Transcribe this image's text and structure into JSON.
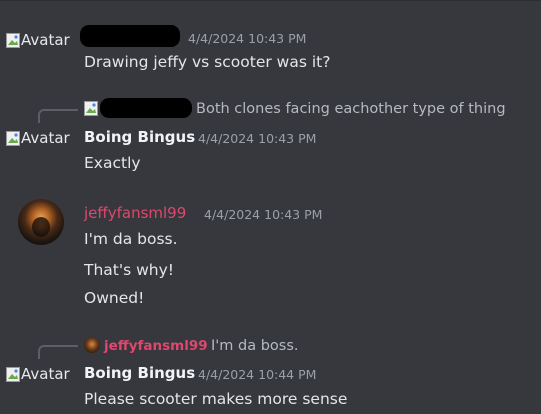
{
  "colors": {
    "background": "#36383d",
    "username_pink": "#e0476e",
    "text": "#e3e5e8",
    "timestamp": "#9aa0a8"
  },
  "messages": [
    {
      "avatar_alt": "Avatar",
      "author_redacted": true,
      "timestamp": "4/4/2024 10:43 PM",
      "lines": [
        "Drawing jeffy vs scooter was it?"
      ]
    },
    {
      "reply": {
        "author_redacted": true,
        "text": "Both clones facing eachother type of thing"
      },
      "avatar_alt": "Avatar",
      "author": "Boing Bingus",
      "timestamp": "4/4/2024 10:43 PM",
      "lines": [
        "Exactly"
      ]
    },
    {
      "avatar_icon": "flame-avatar-icon",
      "author": "jeffyfansml99",
      "timestamp": "4/4/2024 10:43 PM",
      "lines": [
        "I'm da boss.",
        "That's why!",
        "Owned!"
      ]
    },
    {
      "reply": {
        "author": "jeffyfansml99",
        "text": "I'm da boss."
      },
      "avatar_alt": "Avatar",
      "author": "Boing Bingus",
      "timestamp": "4/4/2024 10:44 PM",
      "lines": [
        "Please scooter makes more sense"
      ]
    }
  ]
}
